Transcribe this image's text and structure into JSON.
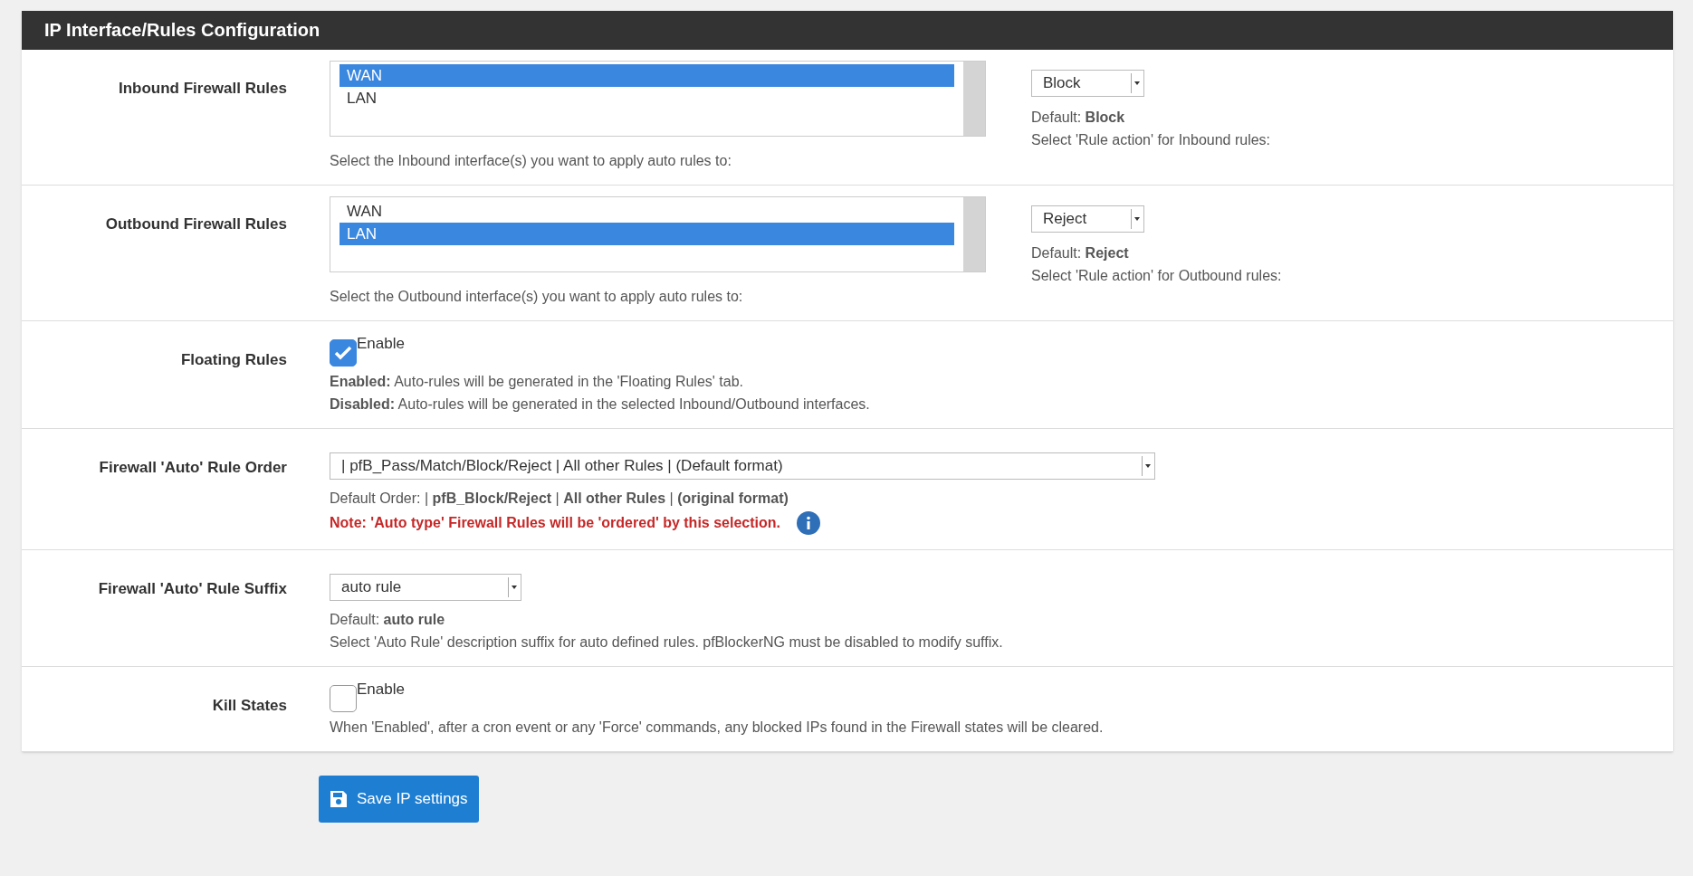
{
  "panel": {
    "title": "IP Interface/Rules Configuration"
  },
  "rows": [
    {
      "kind": "interfaces",
      "label": "Inbound Firewall Rules",
      "options": [
        {
          "label": "WAN",
          "selected": true
        },
        {
          "label": "LAN",
          "selected": false
        }
      ],
      "help": "Select the Inbound interface(s) you want to apply auto rules to:",
      "action": {
        "value": "Block",
        "default": "Default: **Block**",
        "help": "Select 'Rule action' for Inbound rules:"
      }
    },
    {
      "kind": "interfaces",
      "label": "Outbound Firewall Rules",
      "options": [
        {
          "label": "WAN",
          "selected": false
        },
        {
          "label": "LAN",
          "selected": true
        }
      ],
      "help": "Select the Outbound interface(s) you want to apply auto rules to:",
      "action": {
        "value": "Reject",
        "default": "Default: **Reject**",
        "help": "Select 'Rule action' for Outbound rules:"
      }
    },
    {
      "kind": "checkbox",
      "label": "Floating Rules",
      "checked": true,
      "option": "Enable",
      "lines": [
        "**Enabled:** Auto-rules will be generated in the 'Floating Rules' tab.",
        "**Disabled:** Auto-rules will be generated in the selected Inbound/Outbound interfaces."
      ]
    },
    {
      "kind": "select",
      "label": "Firewall 'Auto' Rule Order",
      "value": "| pfB_Pass/Match/Block/Reject | All other Rules | (Default format)",
      "wide": true,
      "lines": [
        "Default Order: | **pfB_Block/Reject** | **All other Rules** | **(original format)**"
      ],
      "note": "Note: 'Auto type' Firewall Rules will be 'ordered' by this selection."
    },
    {
      "kind": "select",
      "label": "Firewall 'Auto' Rule Suffix",
      "value": "auto rule",
      "wide": false,
      "lines": [
        "Default: **auto rule**",
        "Select 'Auto Rule' description suffix for auto defined rules. pfBlockerNG must be disabled to modify suffix."
      ]
    },
    {
      "kind": "checkbox",
      "label": "Kill States",
      "checked": false,
      "option": "Enable",
      "lines": [
        "When 'Enabled', after a cron event or any 'Force' commands, any blocked IPs found in the Firewall states will be cleared."
      ]
    }
  ],
  "save_button": "Save IP settings"
}
